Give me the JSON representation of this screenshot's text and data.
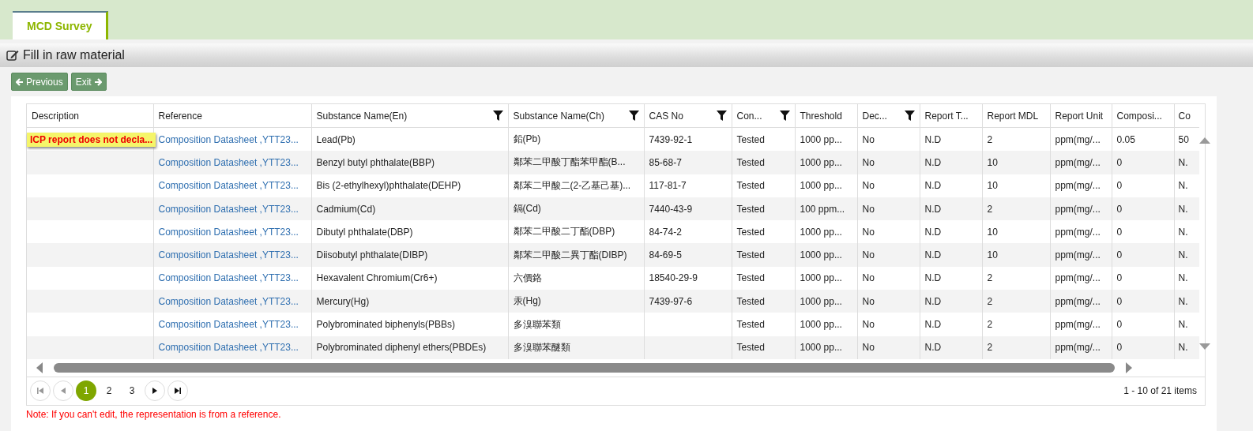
{
  "tabs": [
    {
      "label": "MCD Survey",
      "selected": true
    }
  ],
  "section": {
    "title": "Fill in raw material"
  },
  "buttons": [
    {
      "label": "Previous",
      "kind": "back"
    },
    {
      "label": "Exit",
      "kind": "forward"
    }
  ],
  "table": {
    "columns": [
      {
        "label": "Description",
        "filterable": false,
        "kind": "warning"
      },
      {
        "label": "Reference",
        "filterable": false,
        "kind": "link"
      },
      {
        "label": "Substance Name(En)",
        "filterable": true,
        "kind": "text"
      },
      {
        "label": "Substance Name(Ch)",
        "filterable": true,
        "kind": "text"
      },
      {
        "label": "CAS No",
        "filterable": true,
        "kind": "text"
      },
      {
        "label": "Con...",
        "filterable": true,
        "kind": "text"
      },
      {
        "label": "Threshold",
        "filterable": false,
        "kind": "text"
      },
      {
        "label": "Dec...",
        "filterable": true,
        "kind": "text"
      },
      {
        "label": "Report T...",
        "filterable": false,
        "kind": "text"
      },
      {
        "label": "Report MDL",
        "filterable": false,
        "kind": "text"
      },
      {
        "label": "Report Unit",
        "filterable": false,
        "kind": "text"
      },
      {
        "label": "Composi...",
        "filterable": false,
        "kind": "text"
      },
      {
        "label": "Co",
        "filterable": false,
        "kind": "text"
      }
    ],
    "rows": [
      {
        "cells": [
          "ICP report does not decla...",
          "Composition Datasheet ,YTT23...",
          "Lead(Pb)",
          "鉛(Pb)",
          "7439-92-1",
          "Tested",
          "1000 pp...",
          "No",
          "N.D",
          "2",
          "ppm(mg/...",
          "0.05",
          "50"
        ]
      },
      {
        "cells": [
          "",
          "Composition Datasheet ,YTT23...",
          "Benzyl butyl phthalate(BBP)",
          "鄰苯二甲酸丁酯苯甲酯(B...",
          "85-68-7",
          "Tested",
          "1000 pp...",
          "No",
          "N.D",
          "10",
          "ppm(mg/...",
          "0",
          "N."
        ]
      },
      {
        "cells": [
          "",
          "Composition Datasheet ,YTT23...",
          "Bis (2-ethylhexyl)phthalate(DEHP)",
          "鄰苯二甲酸二(2-乙基己基)...",
          "117-81-7",
          "Tested",
          "1000 pp...",
          "No",
          "N.D",
          "10",
          "ppm(mg/...",
          "0",
          "N."
        ]
      },
      {
        "cells": [
          "",
          "Composition Datasheet ,YTT23...",
          "Cadmium(Cd)",
          "鎘(Cd)",
          "7440-43-9",
          "Tested",
          "100 ppm...",
          "No",
          "N.D",
          "2",
          "ppm(mg/...",
          "0",
          "N."
        ]
      },
      {
        "cells": [
          "",
          "Composition Datasheet ,YTT23...",
          "Dibutyl phthalate(DBP)",
          "鄰苯二甲酸二丁酯(DBP)",
          "84-74-2",
          "Tested",
          "1000 pp...",
          "No",
          "N.D",
          "10",
          "ppm(mg/...",
          "0",
          "N."
        ]
      },
      {
        "cells": [
          "",
          "Composition Datasheet ,YTT23...",
          "Diisobutyl phthalate(DIBP)",
          "鄰苯二甲酸二異丁酯(DIBP)",
          "84-69-5",
          "Tested",
          "1000 pp...",
          "No",
          "N.D",
          "10",
          "ppm(mg/...",
          "0",
          "N."
        ]
      },
      {
        "cells": [
          "",
          "Composition Datasheet ,YTT23...",
          "Hexavalent Chromium(Cr6+)",
          "六價鉻",
          "18540-29-9",
          "Tested",
          "1000 pp...",
          "No",
          "N.D",
          "2",
          "ppm(mg/...",
          "0",
          "N."
        ]
      },
      {
        "cells": [
          "",
          "Composition Datasheet ,YTT23...",
          "Mercury(Hg)",
          "汞(Hg)",
          "7439-97-6",
          "Tested",
          "1000 pp...",
          "No",
          "N.D",
          "2",
          "ppm(mg/...",
          "0",
          "N."
        ]
      },
      {
        "cells": [
          "",
          "Composition Datasheet ,YTT23...",
          "Polybrominated biphenyls(PBBs)",
          "多溴聯苯類",
          "",
          "Tested",
          "1000 pp...",
          "No",
          "N.D",
          "2",
          "ppm(mg/...",
          "0",
          "N."
        ]
      },
      {
        "cells": [
          "",
          "Composition Datasheet ,YTT23...",
          "Polybrominated diphenyl ethers(PBDEs)",
          "多溴聯苯醚類",
          "",
          "Tested",
          "1000 pp...",
          "No",
          "N.D",
          "2",
          "ppm(mg/...",
          "0",
          "N."
        ]
      }
    ]
  },
  "pager": {
    "nav": [
      {
        "kind": "first",
        "disabled": true
      },
      {
        "kind": "prev",
        "disabled": true
      }
    ],
    "pages": [
      {
        "label": "1",
        "selected": true
      },
      {
        "label": "2",
        "selected": false
      },
      {
        "label": "3",
        "selected": false
      }
    ],
    "nav_after": [
      {
        "kind": "next",
        "disabled": false
      },
      {
        "kind": "last",
        "disabled": false
      }
    ],
    "info": "1 - 10 of 21 items"
  },
  "note": "Note: If you can't edit, the representation is from a reference."
}
